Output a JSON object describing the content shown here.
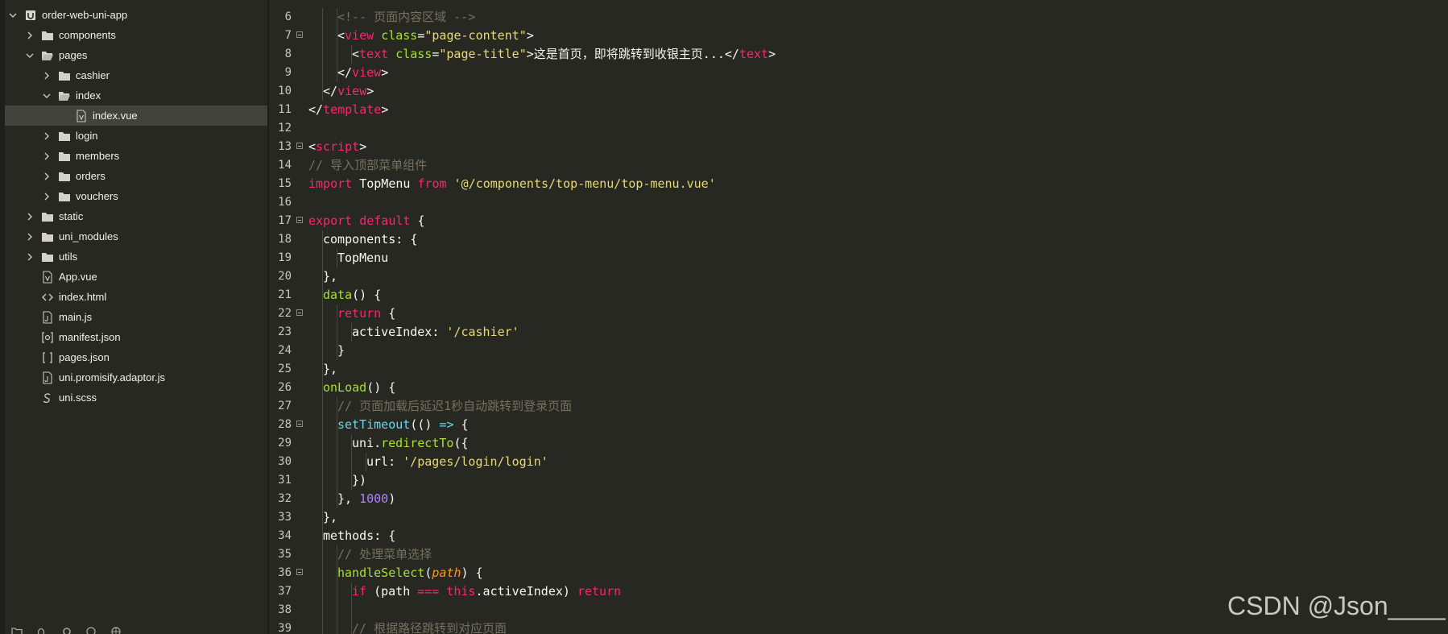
{
  "sidebar": {
    "items": [
      {
        "label": "order-web-uni-app",
        "depth": 0,
        "type": "project",
        "expanded": true
      },
      {
        "label": "components",
        "depth": 1,
        "type": "folder",
        "expanded": false
      },
      {
        "label": "pages",
        "depth": 1,
        "type": "folder",
        "expanded": true
      },
      {
        "label": "cashier",
        "depth": 2,
        "type": "folder",
        "expanded": false
      },
      {
        "label": "index",
        "depth": 2,
        "type": "folder",
        "expanded": true
      },
      {
        "label": "index.vue",
        "depth": 3,
        "type": "vue",
        "selected": true
      },
      {
        "label": "login",
        "depth": 2,
        "type": "folder",
        "expanded": false
      },
      {
        "label": "members",
        "depth": 2,
        "type": "folder",
        "expanded": false
      },
      {
        "label": "orders",
        "depth": 2,
        "type": "folder",
        "expanded": false
      },
      {
        "label": "vouchers",
        "depth": 2,
        "type": "folder",
        "expanded": false
      },
      {
        "label": "static",
        "depth": 1,
        "type": "folder",
        "expanded": false
      },
      {
        "label": "uni_modules",
        "depth": 1,
        "type": "folder",
        "expanded": false
      },
      {
        "label": "utils",
        "depth": 1,
        "type": "folder",
        "expanded": false
      },
      {
        "label": "App.vue",
        "depth": 1,
        "type": "vue"
      },
      {
        "label": "index.html",
        "depth": 1,
        "type": "html"
      },
      {
        "label": "main.js",
        "depth": 1,
        "type": "js"
      },
      {
        "label": "manifest.json",
        "depth": 1,
        "type": "manifest"
      },
      {
        "label": "pages.json",
        "depth": 1,
        "type": "json"
      },
      {
        "label": "uni.promisify.adaptor.js",
        "depth": 1,
        "type": "js"
      },
      {
        "label": "uni.scss",
        "depth": 1,
        "type": "scss"
      }
    ]
  },
  "editor": {
    "lines": [
      {
        "n": "6",
        "fold": false,
        "indent": 2,
        "tokens": [
          [
            "c-comment",
            "<!-- 页面内容区域 -->"
          ]
        ]
      },
      {
        "n": "7",
        "fold": true,
        "indent": 2,
        "tokens": [
          [
            "c-plain",
            "<"
          ],
          [
            "c-tag",
            "view"
          ],
          [
            "c-plain",
            " "
          ],
          [
            "c-attr",
            "class"
          ],
          [
            "c-plain",
            "="
          ],
          [
            "c-str",
            "\"page-content\""
          ],
          [
            "c-plain",
            ">"
          ]
        ]
      },
      {
        "n": "8",
        "fold": false,
        "indent": 3,
        "tokens": [
          [
            "c-plain",
            "<"
          ],
          [
            "c-tag",
            "text"
          ],
          [
            "c-plain",
            " "
          ],
          [
            "c-attr",
            "class"
          ],
          [
            "c-plain",
            "="
          ],
          [
            "c-str",
            "\"page-title\""
          ],
          [
            "c-plain",
            ">这是首页，即将跳转到收银主页...</"
          ],
          [
            "c-tag",
            "text"
          ],
          [
            "c-plain",
            ">"
          ]
        ]
      },
      {
        "n": "9",
        "fold": false,
        "indent": 2,
        "tokens": [
          [
            "c-plain",
            "</"
          ],
          [
            "c-tag",
            "view"
          ],
          [
            "c-plain",
            ">"
          ]
        ]
      },
      {
        "n": "10",
        "fold": false,
        "indent": 1,
        "tokens": [
          [
            "c-plain",
            "</"
          ],
          [
            "c-tag",
            "view"
          ],
          [
            "c-plain",
            ">"
          ]
        ]
      },
      {
        "n": "11",
        "fold": false,
        "indent": 0,
        "tokens": [
          [
            "c-plain",
            "</"
          ],
          [
            "c-tag",
            "template"
          ],
          [
            "c-plain",
            ">"
          ]
        ]
      },
      {
        "n": "12",
        "fold": false,
        "indent": 0,
        "tokens": []
      },
      {
        "n": "13",
        "fold": true,
        "indent": 0,
        "tokens": [
          [
            "c-plain",
            "<"
          ],
          [
            "c-tag",
            "script"
          ],
          [
            "c-plain",
            ">"
          ]
        ]
      },
      {
        "n": "14",
        "fold": false,
        "indent": 0,
        "tokens": [
          [
            "c-comment",
            "// 导入顶部菜单组件"
          ]
        ]
      },
      {
        "n": "15",
        "fold": false,
        "indent": 0,
        "tokens": [
          [
            "c-kw",
            "import"
          ],
          [
            "c-plain",
            " TopMenu "
          ],
          [
            "c-kw",
            "from"
          ],
          [
            "c-plain",
            " "
          ],
          [
            "c-str",
            "'@/components/top-menu/top-menu.vue'"
          ]
        ]
      },
      {
        "n": "16",
        "fold": false,
        "indent": 0,
        "tokens": []
      },
      {
        "n": "17",
        "fold": true,
        "indent": 0,
        "tokens": [
          [
            "c-kw",
            "export"
          ],
          [
            "c-plain",
            " "
          ],
          [
            "c-kw",
            "default"
          ],
          [
            "c-plain",
            " {"
          ]
        ]
      },
      {
        "n": "18",
        "fold": false,
        "indent": 1,
        "tokens": [
          [
            "c-plain",
            "components: {"
          ]
        ]
      },
      {
        "n": "19",
        "fold": false,
        "indent": 2,
        "tokens": [
          [
            "c-plain",
            "TopMenu"
          ]
        ]
      },
      {
        "n": "20",
        "fold": false,
        "indent": 1,
        "tokens": [
          [
            "c-plain",
            "},"
          ]
        ]
      },
      {
        "n": "21",
        "fold": false,
        "indent": 1,
        "tokens": [
          [
            "c-func",
            "data"
          ],
          [
            "c-plain",
            "() {"
          ]
        ]
      },
      {
        "n": "22",
        "fold": true,
        "indent": 2,
        "tokens": [
          [
            "c-kw",
            "return"
          ],
          [
            "c-plain",
            " {"
          ]
        ]
      },
      {
        "n": "23",
        "fold": false,
        "indent": 3,
        "tokens": [
          [
            "c-plain",
            "activeIndex: "
          ],
          [
            "c-str",
            "'/cashier'"
          ]
        ]
      },
      {
        "n": "24",
        "fold": false,
        "indent": 2,
        "tokens": [
          [
            "c-plain",
            "}"
          ]
        ]
      },
      {
        "n": "25",
        "fold": false,
        "indent": 1,
        "tokens": [
          [
            "c-plain",
            "},"
          ]
        ]
      },
      {
        "n": "26",
        "fold": false,
        "indent": 1,
        "tokens": [
          [
            "c-func",
            "onLoad"
          ],
          [
            "c-plain",
            "() {"
          ]
        ]
      },
      {
        "n": "27",
        "fold": false,
        "indent": 2,
        "tokens": [
          [
            "c-comment",
            "// 页面加载后延迟1秒自动跳转到登录页面"
          ]
        ]
      },
      {
        "n": "28",
        "fold": true,
        "indent": 2,
        "tokens": [
          [
            "c-blue",
            "setTimeout"
          ],
          [
            "c-plain",
            "(() "
          ],
          [
            "c-blue",
            "=>"
          ],
          [
            "c-plain",
            " {"
          ]
        ]
      },
      {
        "n": "29",
        "fold": false,
        "indent": 3,
        "tokens": [
          [
            "c-plain",
            "uni."
          ],
          [
            "c-func",
            "redirectTo"
          ],
          [
            "c-plain",
            "({"
          ]
        ]
      },
      {
        "n": "30",
        "fold": false,
        "indent": 4,
        "tokens": [
          [
            "c-plain",
            "url: "
          ],
          [
            "c-str",
            "'/pages/login/login'"
          ]
        ]
      },
      {
        "n": "31",
        "fold": false,
        "indent": 3,
        "tokens": [
          [
            "c-plain",
            "})"
          ]
        ]
      },
      {
        "n": "32",
        "fold": false,
        "indent": 2,
        "tokens": [
          [
            "c-plain",
            "}, "
          ],
          [
            "c-num",
            "1000"
          ],
          [
            "c-plain",
            ")"
          ]
        ]
      },
      {
        "n": "33",
        "fold": false,
        "indent": 1,
        "tokens": [
          [
            "c-plain",
            "},"
          ]
        ]
      },
      {
        "n": "34",
        "fold": false,
        "indent": 1,
        "tokens": [
          [
            "c-plain",
            "methods: {"
          ]
        ]
      },
      {
        "n": "35",
        "fold": false,
        "indent": 2,
        "tokens": [
          [
            "c-comment",
            "// 处理菜单选择"
          ]
        ]
      },
      {
        "n": "36",
        "fold": true,
        "indent": 2,
        "tokens": [
          [
            "c-func",
            "handleSelect"
          ],
          [
            "c-plain",
            "("
          ],
          [
            "c-ital",
            "path"
          ],
          [
            "c-plain",
            ") {"
          ]
        ]
      },
      {
        "n": "37",
        "fold": false,
        "indent": 3,
        "tokens": [
          [
            "c-kw",
            "if"
          ],
          [
            "c-plain",
            " (path "
          ],
          [
            "c-kw",
            "==="
          ],
          [
            "c-plain",
            " "
          ],
          [
            "c-kw",
            "this"
          ],
          [
            "c-plain",
            ".activeIndex) "
          ],
          [
            "c-kw",
            "return"
          ]
        ]
      },
      {
        "n": "38",
        "fold": false,
        "indent": 3,
        "tokens": []
      },
      {
        "n": "39",
        "fold": false,
        "indent": 3,
        "tokens": [
          [
            "c-comment",
            "// 根据路径跳转到对应页面"
          ]
        ]
      }
    ]
  },
  "watermark": "CSDN @Json____",
  "icons": {
    "toolbar": [
      "folder-icon",
      "bug-icon",
      "gear-icon",
      "cloud-icon",
      "globe-icon"
    ]
  },
  "colors": {
    "background": "#272822",
    "selection": "#43433d",
    "tag": "#f92672",
    "string": "#e6db74",
    "comment": "#75715e",
    "function": "#a6e22e",
    "number": "#ae81ff"
  }
}
